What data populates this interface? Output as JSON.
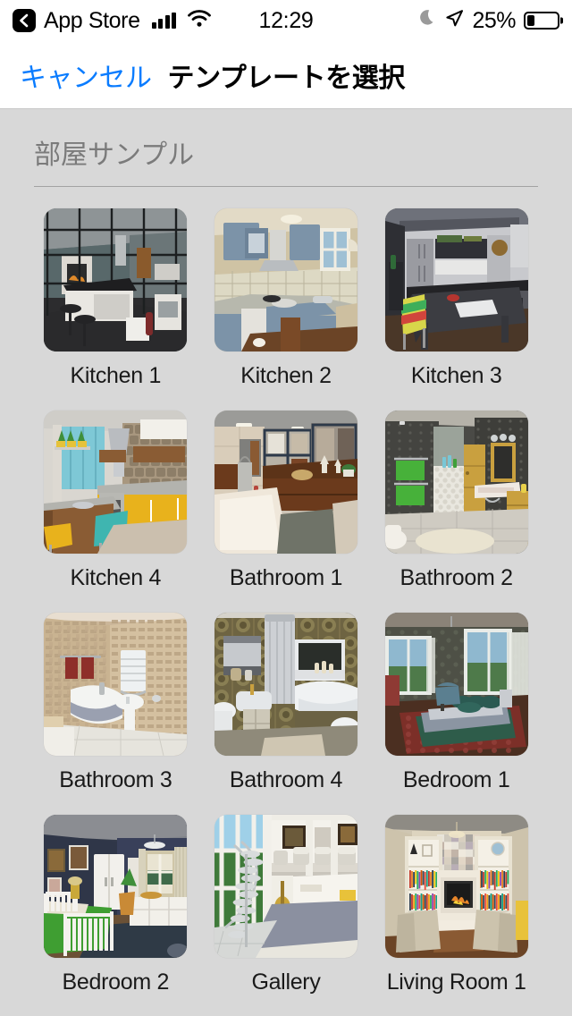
{
  "status_bar": {
    "back_label": "App Store",
    "back_icon": "chevron-left-icon",
    "signal_icon": "cellular-signal-icon",
    "wifi_icon": "wifi-icon",
    "time": "12:29",
    "moon_icon": "crescent-moon-icon",
    "location_icon": "location-arrow-icon",
    "battery_percent": "25%",
    "battery_level": 25
  },
  "nav_bar": {
    "cancel_label": "キャンセル",
    "title": "テンプレートを選択",
    "cancel_color": "#0a7cff"
  },
  "section": {
    "title": "部屋サンプル"
  },
  "templates": [
    {
      "label": "Kitchen 1",
      "scene": "kitchen1"
    },
    {
      "label": "Kitchen 2",
      "scene": "kitchen2"
    },
    {
      "label": "Kitchen 3",
      "scene": "kitchen3"
    },
    {
      "label": "Kitchen 4",
      "scene": "kitchen4"
    },
    {
      "label": "Bathroom 1",
      "scene": "bathroom1"
    },
    {
      "label": "Bathroom 2",
      "scene": "bathroom2"
    },
    {
      "label": "Bathroom 3",
      "scene": "bathroom3"
    },
    {
      "label": "Bathroom 4",
      "scene": "bathroom4"
    },
    {
      "label": "Bedroom 1",
      "scene": "bedroom1"
    },
    {
      "label": "Bedroom 2",
      "scene": "bedroom2"
    },
    {
      "label": "Gallery",
      "scene": "gallery"
    },
    {
      "label": "Living Room 1",
      "scene": "livingroom1"
    }
  ],
  "colors": {
    "page_background": "#d8d8d8",
    "bar_background": "#ffffff",
    "accent": "#0a7cff",
    "section_title": "#7b7b7b",
    "label": "#1a1a1a"
  }
}
